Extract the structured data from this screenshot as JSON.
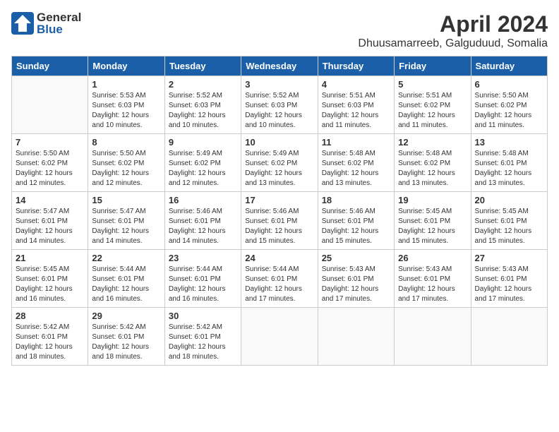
{
  "header": {
    "logo_general": "General",
    "logo_blue": "Blue",
    "month": "April 2024",
    "location": "Dhuusamarreeb, Galguduud, Somalia"
  },
  "weekdays": [
    "Sunday",
    "Monday",
    "Tuesday",
    "Wednesday",
    "Thursday",
    "Friday",
    "Saturday"
  ],
  "weeks": [
    [
      {
        "day": "",
        "sunrise": "",
        "sunset": "",
        "daylight": ""
      },
      {
        "day": "1",
        "sunrise": "5:53 AM",
        "sunset": "6:03 PM",
        "daylight": "12 hours and 10 minutes."
      },
      {
        "day": "2",
        "sunrise": "5:52 AM",
        "sunset": "6:03 PM",
        "daylight": "12 hours and 10 minutes."
      },
      {
        "day": "3",
        "sunrise": "5:52 AM",
        "sunset": "6:03 PM",
        "daylight": "12 hours and 10 minutes."
      },
      {
        "day": "4",
        "sunrise": "5:51 AM",
        "sunset": "6:03 PM",
        "daylight": "12 hours and 11 minutes."
      },
      {
        "day": "5",
        "sunrise": "5:51 AM",
        "sunset": "6:02 PM",
        "daylight": "12 hours and 11 minutes."
      },
      {
        "day": "6",
        "sunrise": "5:50 AM",
        "sunset": "6:02 PM",
        "daylight": "12 hours and 11 minutes."
      }
    ],
    [
      {
        "day": "7",
        "sunrise": "5:50 AM",
        "sunset": "6:02 PM",
        "daylight": "12 hours and 12 minutes."
      },
      {
        "day": "8",
        "sunrise": "5:50 AM",
        "sunset": "6:02 PM",
        "daylight": "12 hours and 12 minutes."
      },
      {
        "day": "9",
        "sunrise": "5:49 AM",
        "sunset": "6:02 PM",
        "daylight": "12 hours and 12 minutes."
      },
      {
        "day": "10",
        "sunrise": "5:49 AM",
        "sunset": "6:02 PM",
        "daylight": "12 hours and 13 minutes."
      },
      {
        "day": "11",
        "sunrise": "5:48 AM",
        "sunset": "6:02 PM",
        "daylight": "12 hours and 13 minutes."
      },
      {
        "day": "12",
        "sunrise": "5:48 AM",
        "sunset": "6:02 PM",
        "daylight": "12 hours and 13 minutes."
      },
      {
        "day": "13",
        "sunrise": "5:48 AM",
        "sunset": "6:01 PM",
        "daylight": "12 hours and 13 minutes."
      }
    ],
    [
      {
        "day": "14",
        "sunrise": "5:47 AM",
        "sunset": "6:01 PM",
        "daylight": "12 hours and 14 minutes."
      },
      {
        "day": "15",
        "sunrise": "5:47 AM",
        "sunset": "6:01 PM",
        "daylight": "12 hours and 14 minutes."
      },
      {
        "day": "16",
        "sunrise": "5:46 AM",
        "sunset": "6:01 PM",
        "daylight": "12 hours and 14 minutes."
      },
      {
        "day": "17",
        "sunrise": "5:46 AM",
        "sunset": "6:01 PM",
        "daylight": "12 hours and 15 minutes."
      },
      {
        "day": "18",
        "sunrise": "5:46 AM",
        "sunset": "6:01 PM",
        "daylight": "12 hours and 15 minutes."
      },
      {
        "day": "19",
        "sunrise": "5:45 AM",
        "sunset": "6:01 PM",
        "daylight": "12 hours and 15 minutes."
      },
      {
        "day": "20",
        "sunrise": "5:45 AM",
        "sunset": "6:01 PM",
        "daylight": "12 hours and 15 minutes."
      }
    ],
    [
      {
        "day": "21",
        "sunrise": "5:45 AM",
        "sunset": "6:01 PM",
        "daylight": "12 hours and 16 minutes."
      },
      {
        "day": "22",
        "sunrise": "5:44 AM",
        "sunset": "6:01 PM",
        "daylight": "12 hours and 16 minutes."
      },
      {
        "day": "23",
        "sunrise": "5:44 AM",
        "sunset": "6:01 PM",
        "daylight": "12 hours and 16 minutes."
      },
      {
        "day": "24",
        "sunrise": "5:44 AM",
        "sunset": "6:01 PM",
        "daylight": "12 hours and 17 minutes."
      },
      {
        "day": "25",
        "sunrise": "5:43 AM",
        "sunset": "6:01 PM",
        "daylight": "12 hours and 17 minutes."
      },
      {
        "day": "26",
        "sunrise": "5:43 AM",
        "sunset": "6:01 PM",
        "daylight": "12 hours and 17 minutes."
      },
      {
        "day": "27",
        "sunrise": "5:43 AM",
        "sunset": "6:01 PM",
        "daylight": "12 hours and 17 minutes."
      }
    ],
    [
      {
        "day": "28",
        "sunrise": "5:42 AM",
        "sunset": "6:01 PM",
        "daylight": "12 hours and 18 minutes."
      },
      {
        "day": "29",
        "sunrise": "5:42 AM",
        "sunset": "6:01 PM",
        "daylight": "12 hours and 18 minutes."
      },
      {
        "day": "30",
        "sunrise": "5:42 AM",
        "sunset": "6:01 PM",
        "daylight": "12 hours and 18 minutes."
      },
      {
        "day": "",
        "sunrise": "",
        "sunset": "",
        "daylight": ""
      },
      {
        "day": "",
        "sunrise": "",
        "sunset": "",
        "daylight": ""
      },
      {
        "day": "",
        "sunrise": "",
        "sunset": "",
        "daylight": ""
      },
      {
        "day": "",
        "sunrise": "",
        "sunset": "",
        "daylight": ""
      }
    ]
  ]
}
